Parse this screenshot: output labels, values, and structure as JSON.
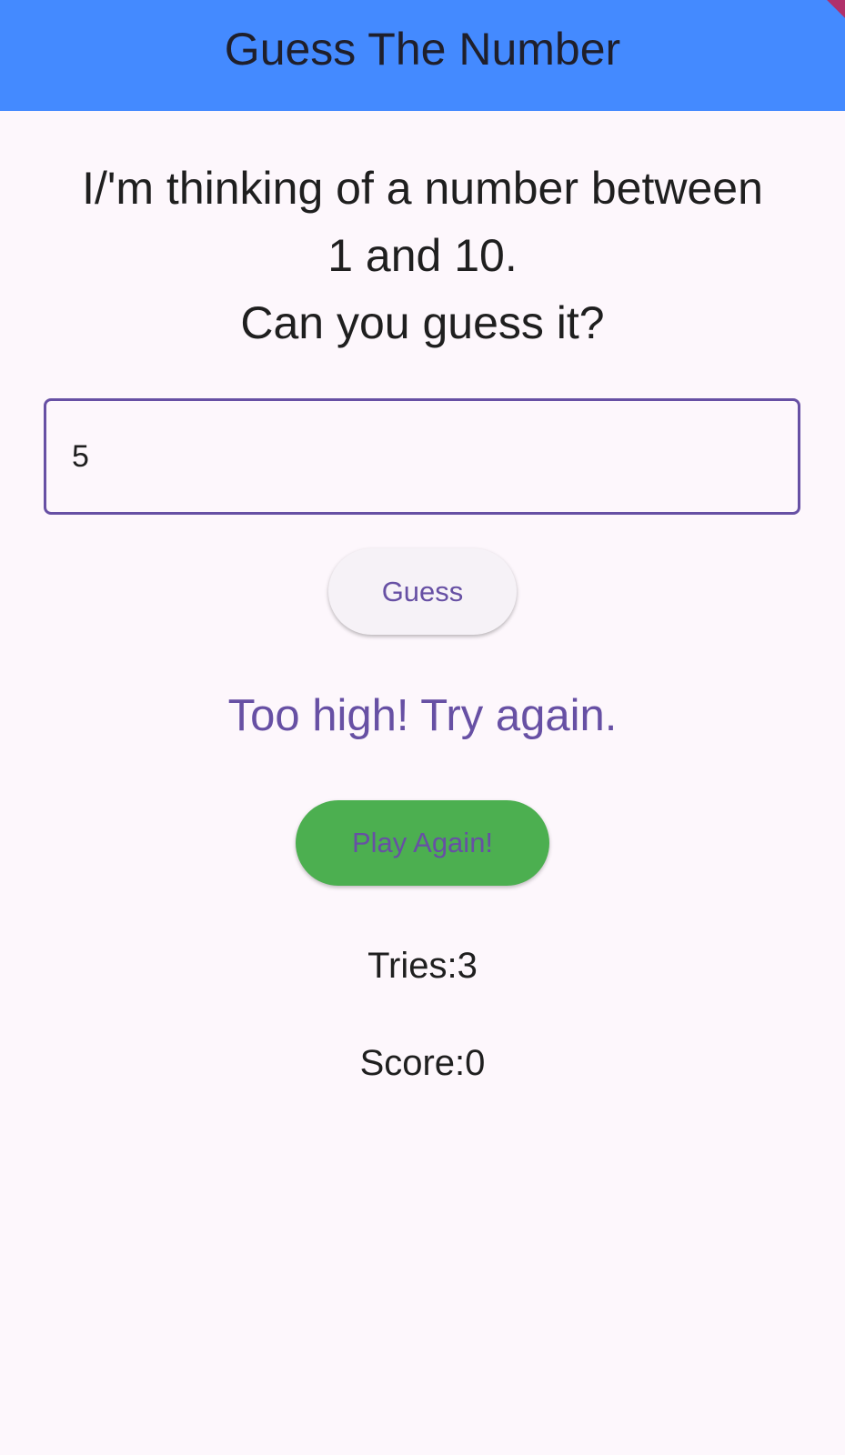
{
  "app_bar": {
    "title": "Guess The Number",
    "background_color": "#448aff"
  },
  "prompt": {
    "line_1": "I/'m thinking of a number between",
    "line_2": "1 and 10.",
    "line_3": "Can you guess it?"
  },
  "guess_input": {
    "value": "5"
  },
  "buttons": {
    "guess_label": "Guess",
    "play_again_label": "Play Again!"
  },
  "feedback": {
    "message": "Too high! Try again."
  },
  "stats": {
    "tries": "Tries:3",
    "score": "Score:0"
  },
  "colors": {
    "accent": "#6750a4",
    "play_again_bg": "#4caf50",
    "page_bg": "#fdf7fc"
  }
}
